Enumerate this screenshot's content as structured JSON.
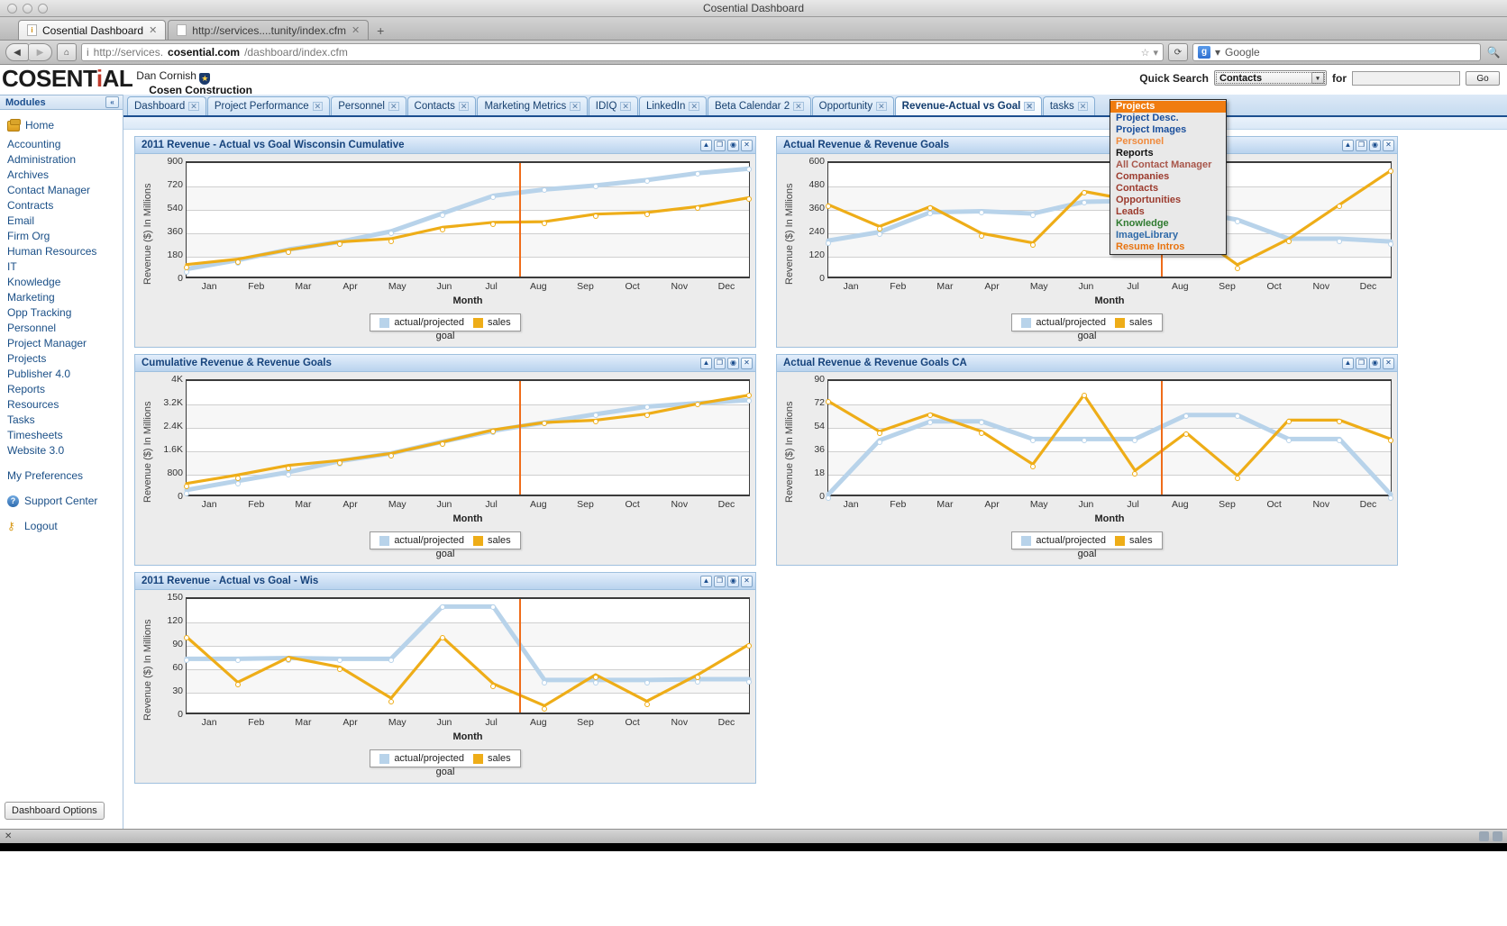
{
  "os": {
    "window_title": "Cosential Dashboard"
  },
  "browser": {
    "tabs": [
      {
        "label": "Cosential Dashboard",
        "active": true,
        "close": "✕"
      },
      {
        "label": "http://services....tunity/index.cfm",
        "active": false,
        "close": "✕"
      }
    ],
    "new_tab": "+",
    "back_icon": "◀",
    "forward_icon": "▶",
    "home_icon": "⌂",
    "url_prefix": "http://services.",
    "url_domain": "cosential.com",
    "url_path": "/dashboard/index.cfm",
    "bookmark_icon": "☆",
    "bookmark_caret": "▾",
    "reload_icon": "⟳",
    "search_placeholder": "Google",
    "search_caret": "▾",
    "search_icon": "🔍",
    "google_glyph": "g"
  },
  "app": {
    "logo_text": "COSENTiAL",
    "user_name": "Dan Cornish",
    "company": "Cosen Construction",
    "quick_search": {
      "label": "Quick Search",
      "selected": "Contacts",
      "for_label": "for",
      "input_value": "",
      "go_label": "Go",
      "caret": "▾",
      "options": [
        {
          "label": "Projects",
          "color": "#ffffff",
          "selected": true
        },
        {
          "label": "Project Desc.",
          "color": "#1a4f9c"
        },
        {
          "label": "Project Images",
          "color": "#1a4f9c"
        },
        {
          "label": "Personnel",
          "color": "#f08a3c"
        },
        {
          "label": "Reports",
          "color": "#111111"
        },
        {
          "label": "All Contact Manager",
          "color": "#a8564a"
        },
        {
          "label": "Companies",
          "color": "#9c3b2e"
        },
        {
          "label": "Contacts",
          "color": "#9c3b2e"
        },
        {
          "label": "Opportunities",
          "color": "#9c3b2e"
        },
        {
          "label": "Leads",
          "color": "#9c3b2e"
        },
        {
          "label": "Knowledge",
          "color": "#2f7a2f"
        },
        {
          "label": "ImageLibrary",
          "color": "#2f6aa8"
        },
        {
          "label": "Resume Intros",
          "color": "#e8730f"
        }
      ]
    }
  },
  "sidebar": {
    "header": "Modules",
    "collapse_icon": "«",
    "home": {
      "label": "Home",
      "icon": "home-icon"
    },
    "items": [
      {
        "label": "Accounting"
      },
      {
        "label": "Administration"
      },
      {
        "label": "Archives"
      },
      {
        "label": "Contact Manager"
      },
      {
        "label": "Contracts"
      },
      {
        "label": "Email"
      },
      {
        "label": "Firm Org"
      },
      {
        "label": "Human Resources"
      },
      {
        "label": "IT"
      },
      {
        "label": "Knowledge"
      },
      {
        "label": "Marketing"
      },
      {
        "label": "Opp Tracking"
      },
      {
        "label": "Personnel"
      },
      {
        "label": "Project Manager"
      },
      {
        "label": "Projects"
      },
      {
        "label": "Publisher 4.0"
      },
      {
        "label": "Reports"
      },
      {
        "label": "Resources"
      },
      {
        "label": "Tasks"
      },
      {
        "label": "Timesheets"
      },
      {
        "label": "Website 3.0"
      }
    ],
    "preferences": {
      "label": "My Preferences"
    },
    "support": {
      "label": "Support Center",
      "icon": "question-circle-icon"
    },
    "logout": {
      "label": "Logout",
      "icon": "key-icon"
    },
    "dashboard_options": "Dashboard Options"
  },
  "page_tabs": [
    {
      "label": "Dashboard",
      "active": false,
      "close": "✕"
    },
    {
      "label": "Project Performance",
      "active": false,
      "close": "✕"
    },
    {
      "label": "Personnel",
      "active": false,
      "close": "✕"
    },
    {
      "label": "Contacts",
      "active": false,
      "close": "✕"
    },
    {
      "label": "Marketing Metrics",
      "active": false,
      "close": "✕"
    },
    {
      "label": "IDIQ",
      "active": false,
      "close": "✕"
    },
    {
      "label": "LinkedIn",
      "active": false,
      "close": "✕"
    },
    {
      "label": "Beta Calendar 2",
      "active": false,
      "close": "✕"
    },
    {
      "label": "Opportunity",
      "active": false,
      "close": "✕"
    },
    {
      "label": "Revenue-Actual vs Goal",
      "active": true,
      "close": "✕"
    },
    {
      "label": "tasks",
      "active": false,
      "close": "✕"
    }
  ],
  "portlet_controls": {
    "collapse": "▲",
    "restore": "❐",
    "settings": "◉",
    "close": "✕"
  },
  "legend": {
    "series1": "actual/projected",
    "series2_line1": "sales",
    "series2_line2": "goal"
  },
  "colors": {
    "actual_projected": "#b8d3ea",
    "sales_goal": "#eead18",
    "now_marker": "#ef6c1a",
    "panel_title": "#16437c",
    "highlight": "#f07c10"
  },
  "chart_data": [
    {
      "id": "wisconsin-cumulative",
      "type": "line",
      "title": "2011 Revenue - Actual vs Goal Wisconsin Cumulative",
      "xlabel": "Month",
      "ylabel": "Revenue ($) In Millions",
      "categories": [
        "Jan",
        "Feb",
        "Mar",
        "Apr",
        "May",
        "Jun",
        "Jul",
        "Aug",
        "Sep",
        "Oct",
        "Nov",
        "Dec"
      ],
      "yticks": [
        0,
        180,
        360,
        540,
        720,
        900
      ],
      "ylim": [
        0,
        900
      ],
      "now_marker_after": "Jul",
      "grid": true,
      "legend_position": "bottom",
      "series": [
        {
          "name": "actual/projected",
          "color": "#b8d3ea",
          "values": [
            60,
            130,
            215,
            275,
            358,
            500,
            640,
            690,
            722,
            765,
            820,
            855
          ]
        },
        {
          "name": "sales goal",
          "color": "#eead18",
          "values": [
            95,
            138,
            212,
            275,
            300,
            390,
            430,
            435,
            495,
            508,
            555,
            625
          ]
        }
      ]
    },
    {
      "id": "actual-revenue-goals",
      "type": "line",
      "title": "Actual Revenue & Revenue Goals",
      "xlabel": "Month",
      "ylabel": "Revenue ($) In Millions",
      "categories": [
        "Jan",
        "Feb",
        "Mar",
        "Apr",
        "May",
        "Jun",
        "Jul",
        "Aug",
        "Sep",
        "Oct",
        "Nov",
        "Dec"
      ],
      "yticks": [
        0,
        120,
        240,
        360,
        480,
        600
      ],
      "ylim": [
        0,
        600
      ],
      "now_marker_after": "Jul",
      "grid": true,
      "legend_position": "bottom",
      "series": [
        {
          "name": "actual/projected",
          "color": "#b8d3ea",
          "values": [
            190,
            235,
            340,
            345,
            333,
            395,
            400,
            350,
            300,
            200,
            200,
            185
          ]
        },
        {
          "name": "sales goal",
          "color": "#eead18",
          "values": [
            380,
            265,
            370,
            228,
            178,
            450,
            400,
            255,
            62,
            198,
            380,
            560
          ]
        }
      ]
    },
    {
      "id": "cumulative-revenue-goals",
      "type": "line",
      "title": "Cumulative Revenue & Revenue Goals",
      "xlabel": "Month",
      "ylabel": "Revenue ($) In Millions",
      "categories": [
        "Jan",
        "Feb",
        "Mar",
        "Apr",
        "May",
        "Jun",
        "Jul",
        "Aug",
        "Sep",
        "Oct",
        "Nov",
        "Dec"
      ],
      "yticks": [
        "0",
        "800",
        "1.6K",
        "2.4K",
        "3.2K",
        "4K"
      ],
      "ylim": [
        0,
        4000
      ],
      "now_marker_after": "Jul",
      "grid": true,
      "legend_position": "bottom",
      "series": [
        {
          "name": "actual/projected",
          "color": "#b8d3ea",
          "values": [
            160,
            480,
            790,
            1180,
            1450,
            1860,
            2250,
            2540,
            2830,
            3100,
            3220,
            3330
          ]
        },
        {
          "name": "sales goal",
          "color": "#eead18",
          "values": [
            390,
            690,
            1030,
            1200,
            1450,
            1850,
            2280,
            2540,
            2620,
            2840,
            3200,
            3500
          ]
        }
      ]
    },
    {
      "id": "actual-revenue-goals-ca",
      "type": "line",
      "title": "Actual Revenue & Revenue Goals CA",
      "xlabel": "Month",
      "ylabel": "Revenue ($) In Millions",
      "categories": [
        "Jan",
        "Feb",
        "Mar",
        "Apr",
        "May",
        "Jun",
        "Jul",
        "Aug",
        "Sep",
        "Oct",
        "Nov",
        "Dec"
      ],
      "yticks": [
        0,
        18,
        36,
        54,
        72,
        90
      ],
      "ylim": [
        0,
        90
      ],
      "now_marker_after": "Jul",
      "grid": true,
      "legend_position": "bottom",
      "series": [
        {
          "name": "actual/projected",
          "color": "#b8d3ea",
          "values": [
            0,
            43,
            58,
            58,
            44,
            44,
            44,
            63,
            63,
            44,
            44,
            0
          ]
        },
        {
          "name": "sales goal",
          "color": "#eead18",
          "values": [
            74,
            50,
            64,
            50,
            24,
            79,
            19,
            49,
            15,
            59,
            59,
            44
          ]
        }
      ]
    },
    {
      "id": "wisconsin-monthly",
      "type": "line",
      "title": "2011 Revenue - Actual vs Goal - Wis",
      "xlabel": "Month",
      "ylabel": "Revenue ($) In Millions",
      "categories": [
        "Jan",
        "Feb",
        "Mar",
        "Apr",
        "May",
        "Jun",
        "Jul",
        "Aug",
        "Sep",
        "Oct",
        "Nov",
        "Dec"
      ],
      "yticks": [
        0,
        30,
        60,
        90,
        120,
        150
      ],
      "ylim": [
        0,
        150
      ],
      "now_marker_after": "Jul",
      "grid": true,
      "legend_position": "bottom",
      "series": [
        {
          "name": "actual/projected",
          "color": "#b8d3ea",
          "values": [
            71,
            71,
            72,
            71,
            71,
            140,
            140,
            43,
            43,
            43,
            44,
            44
          ]
        },
        {
          "name": "sales goal",
          "color": "#eead18",
          "values": [
            100,
            40,
            73,
            60,
            19,
            100,
            38,
            9,
            50,
            15,
            50,
            90
          ]
        }
      ]
    }
  ],
  "statusbar": {
    "left_icon": "✕",
    "right_icons": [
      "status-icon-1",
      "status-icon-2"
    ]
  }
}
